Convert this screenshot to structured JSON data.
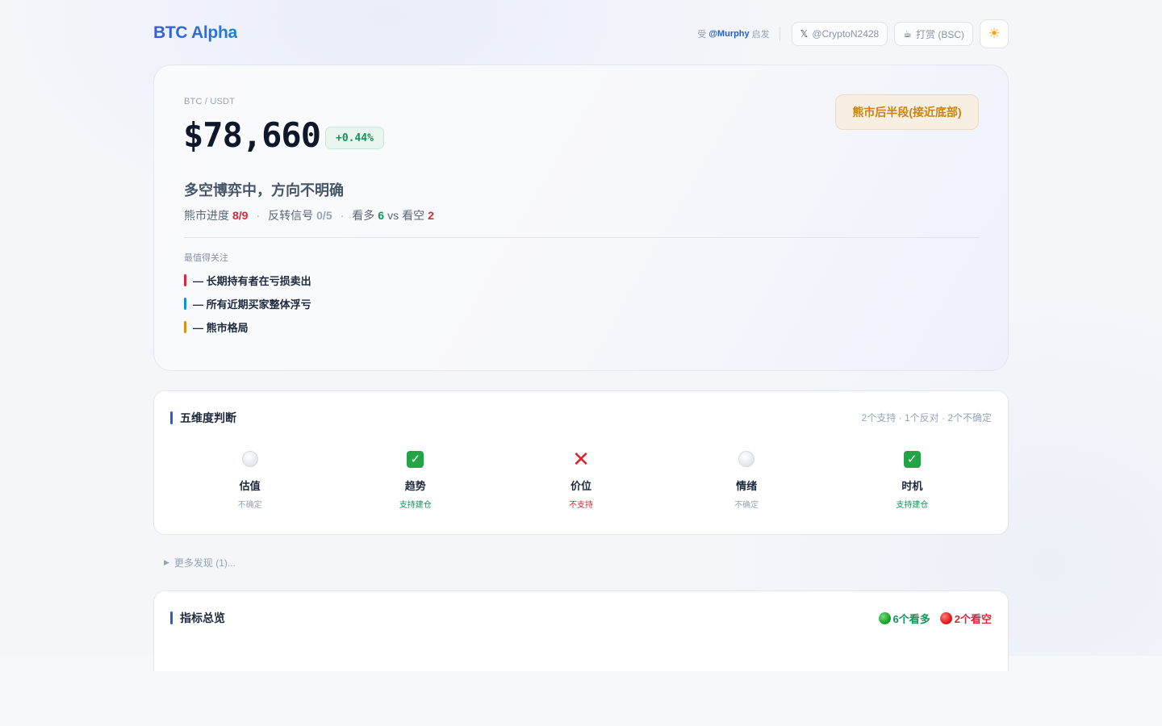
{
  "header": {
    "brand": "BTC Alpha",
    "inspired_prefix": "受",
    "inspired_handle": "@Murphy",
    "inspired_suffix": "启发",
    "x_icon": "x-logo-icon",
    "x_handle": "@CryptoN2428",
    "tip_icon": "coffee-icon",
    "tip_label": "打赏 (BSC)",
    "theme_icon": "sun-icon"
  },
  "hero": {
    "pair": "BTC / USDT",
    "price": "$78,660",
    "change": "+0.44%",
    "phase": "熊市后半段(接近底部)",
    "headline": "多空博弈中，方向不明确",
    "stats": {
      "bear_progress_label": "熊市进度",
      "bear_progress_value": "8/9",
      "reversal_label": "反转信号",
      "reversal_value": "0/5",
      "bull_label": "看多",
      "bull_value": "6",
      "vs": "vs",
      "bear_label": "看空",
      "bear_value": "2"
    },
    "focus_title": "最值得关注",
    "focus_items": [
      {
        "text": "— 长期持有者在亏损卖出",
        "color": "#d62839"
      },
      {
        "text": "— 所有近期买家整体浮亏",
        "color": "#1391c9"
      },
      {
        "text": "— 熊市格局",
        "color": "#d39311"
      }
    ]
  },
  "five_dim": {
    "title": "五维度判断",
    "summary": "2个支持 · 1个反对 · 2个不确定",
    "items": [
      {
        "name": "估值",
        "status": "不确定",
        "icon": "white-circle-icon"
      },
      {
        "name": "趋势",
        "status": "支持建仓",
        "icon": "check-mark-icon"
      },
      {
        "name": "价位",
        "status": "不支持",
        "icon": "cross-mark-icon"
      },
      {
        "name": "情绪",
        "status": "不确定",
        "icon": "white-circle-icon"
      },
      {
        "name": "时机",
        "status": "支持建仓",
        "icon": "check-mark-icon"
      }
    ]
  },
  "more": {
    "label": "更多发现 (1)..."
  },
  "indicators": {
    "title": "指标总览",
    "bull_badge": "6个看多",
    "bear_badge": "2个看空"
  },
  "colors": {
    "accent": "#2563c9",
    "bull": "#14935a",
    "bear": "#d62839",
    "phase": "#c98410"
  }
}
